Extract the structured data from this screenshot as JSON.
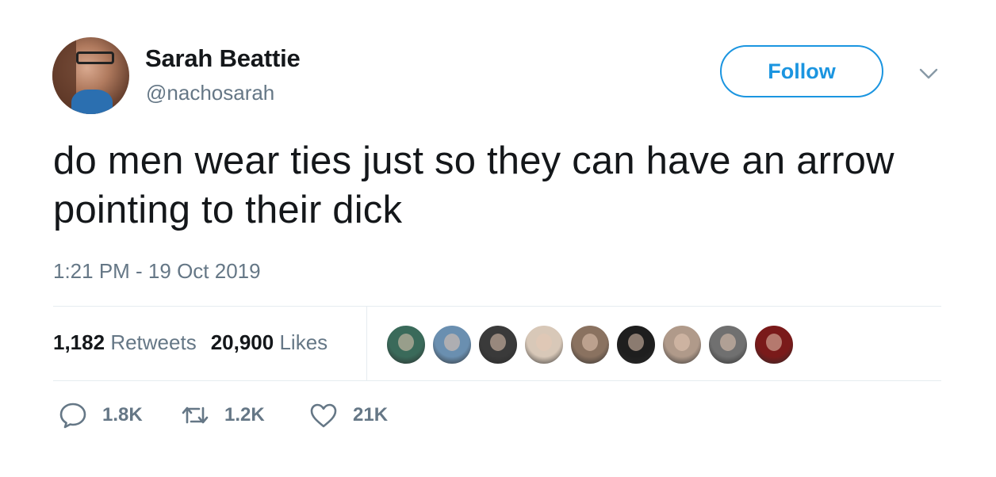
{
  "user": {
    "name": "Sarah Beattie",
    "handle": "@nachosarah"
  },
  "follow_button": {
    "label": "Follow"
  },
  "tweet": {
    "text": "do men wear ties just so they can have an arrow pointing to their dick",
    "timestamp": "1:21 PM - 19 Oct 2019"
  },
  "stats": {
    "retweets_count": "1,182",
    "retweets_label": "Retweets",
    "likes_count": "20,900",
    "likes_label": "Likes"
  },
  "likers": [
    {
      "icon": "liker-avatar-1",
      "color": "#3a6a5a"
    },
    {
      "icon": "liker-avatar-2",
      "color": "#6a8fb0"
    },
    {
      "icon": "liker-avatar-3",
      "color": "#3a3a3a"
    },
    {
      "icon": "liker-avatar-4",
      "color": "#d8c8b8"
    },
    {
      "icon": "liker-avatar-5",
      "color": "#8a7260"
    },
    {
      "icon": "liker-avatar-6",
      "color": "#1e1e1e"
    },
    {
      "icon": "liker-avatar-7",
      "color": "#b09a8a"
    },
    {
      "icon": "liker-avatar-8",
      "color": "#707070"
    },
    {
      "icon": "liker-avatar-9",
      "color": "#7a1a1a"
    }
  ],
  "actions": {
    "reply_count": "1.8K",
    "retweet_count": "1.2K",
    "like_count": "21K"
  },
  "colors": {
    "accent": "#1b95e0",
    "text": "#14171a",
    "secondary": "#657786",
    "divider": "#e6ecf0"
  }
}
